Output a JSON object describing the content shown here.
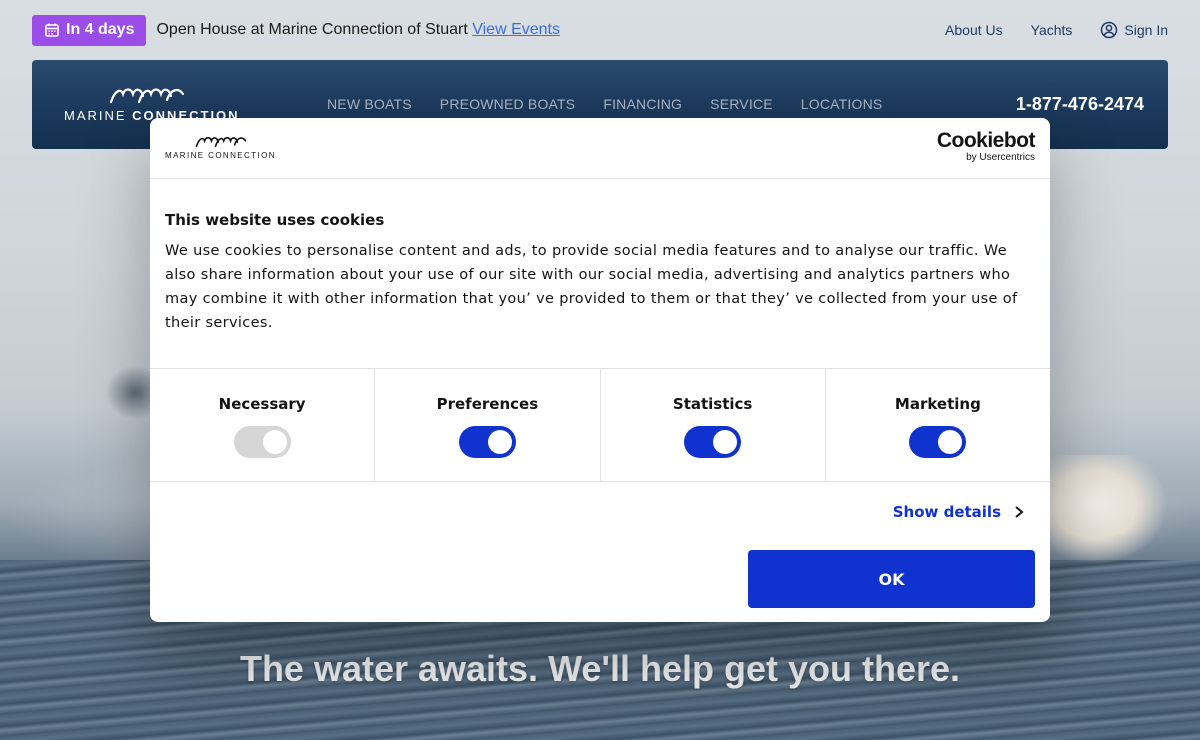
{
  "announcement": {
    "badge_label": "In 4 days",
    "text": "Open House at Marine Connection of Stuart",
    "link_label": "View Events"
  },
  "top_links": {
    "about": "About Us",
    "yachts": "Yachts",
    "sign_in": "Sign In"
  },
  "nav": {
    "logo_text_light": "MARINE ",
    "logo_text_bold": "CONNECTION",
    "items": [
      "NEW BOATS",
      "PREOWNED BOATS",
      "FINANCING",
      "SERVICE",
      "LOCATIONS"
    ],
    "phone": "1-877-476-2474"
  },
  "hero": {
    "heading": "The water awaits. We'll help get you there."
  },
  "cookie_dialog": {
    "logo_text": "MARINE CONNECTION",
    "brand": "Cookiebot",
    "brand_sub": "by Usercentrics",
    "title": "This website uses cookies",
    "body": "We use cookies to personalise content and ads, to provide social media features and to analyse our traffic. We also share information about your use of our site with our social media, advertising and analytics partners who may combine it with other information that you’ ve provided to them or that they’ ve collected from your use of their services.",
    "toggles": [
      {
        "label": "Necessary",
        "on": false
      },
      {
        "label": "Preferences",
        "on": true
      },
      {
        "label": "Statistics",
        "on": true
      },
      {
        "label": "Marketing",
        "on": true
      }
    ],
    "show_details": "Show details",
    "ok": "OK"
  },
  "colors": {
    "accent_blue": "#1032cf",
    "badge_purple": "#9b4de8",
    "nav_navy": "#1d3b5e"
  }
}
